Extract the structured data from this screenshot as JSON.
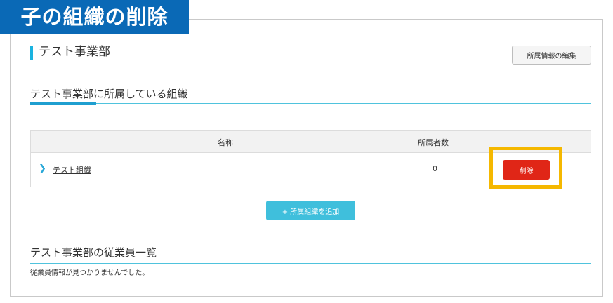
{
  "banner": {
    "title": "子の組織の削除"
  },
  "department": {
    "name": "テスト事業部"
  },
  "actions": {
    "edit_affiliation": "所属情報の編集"
  },
  "org_section": {
    "title": "テスト事業部に所属している組織",
    "columns": {
      "name": "名称",
      "members": "所属者数"
    },
    "rows": [
      {
        "name": "テスト組織",
        "members": "0",
        "action": "削除"
      }
    ],
    "add_button": "+ 所属組織を追加"
  },
  "employee_section": {
    "title": "テスト事業部の従業員一覧",
    "empty_message": "従業員情報が見つかりませんでした。"
  },
  "colors": {
    "banner": "#0a69b6",
    "accent": "#4fc3dd",
    "delete": "#e02617",
    "highlight": "#f5b800",
    "add": "#3fbfdc"
  }
}
